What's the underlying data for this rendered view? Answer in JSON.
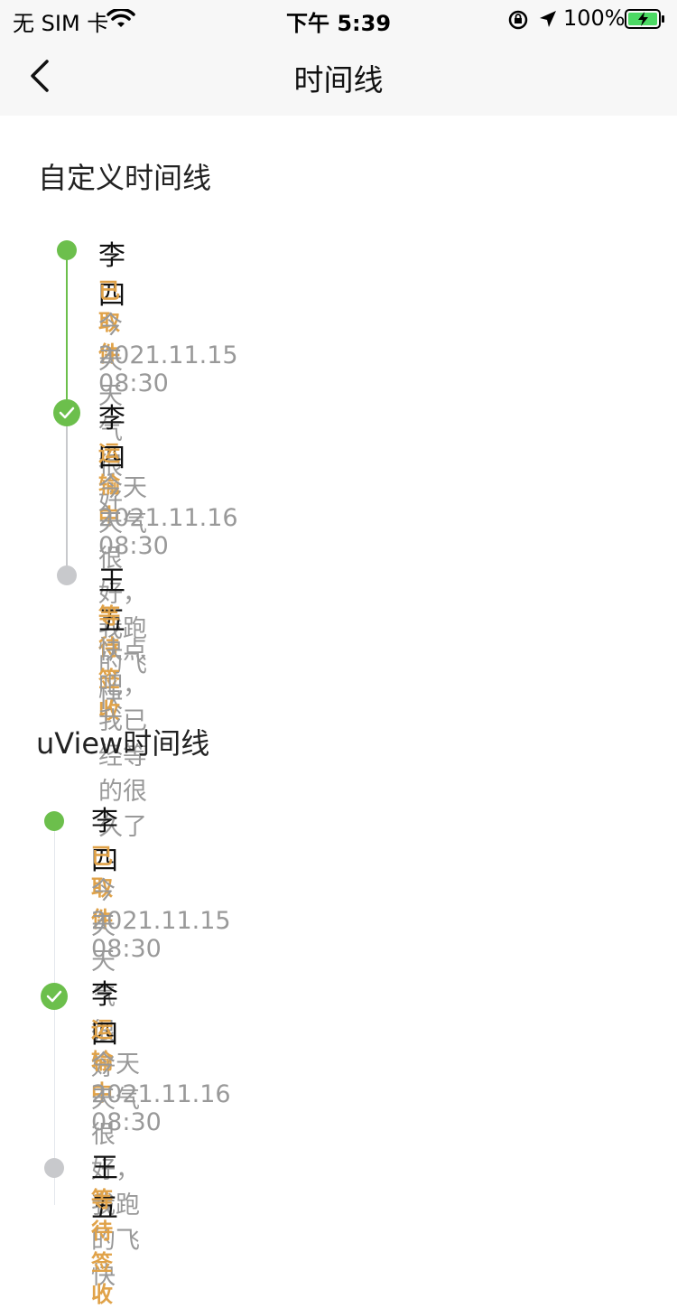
{
  "status_bar": {
    "carrier": "无 SIM 卡",
    "time": "下午 5:39",
    "battery": "100%"
  },
  "nav": {
    "title": "时间线"
  },
  "custom_timeline": {
    "title": "自定义时间线",
    "items": [
      {
        "name": "李四",
        "status": "已取件",
        "desc": "今天天气很好",
        "time": "2021.11.15 08:30"
      },
      {
        "name": "李四",
        "status": "运输中",
        "desc": "今天天气很好，我跑的飞快",
        "time": "2021.11.16 08:30"
      },
      {
        "name": "王五",
        "status": "等待签收",
        "desc": "快点吧，我已经等的很久了"
      }
    ]
  },
  "uview_timeline": {
    "title": "uView时间线",
    "items": [
      {
        "name": "李四",
        "status": "已取件",
        "desc": "今天天气很好",
        "time": "2021.11.15 08:30"
      },
      {
        "name": "李四",
        "status": "运输中",
        "desc": "今天天气很好，我跑的飞快",
        "time": "2021.11.16 08:30"
      },
      {
        "name": "王五",
        "status": "等待签收"
      }
    ]
  },
  "colors": {
    "done": "#6cbf4c",
    "pending": "#c8c9cc",
    "status_text": "#e0a248"
  }
}
